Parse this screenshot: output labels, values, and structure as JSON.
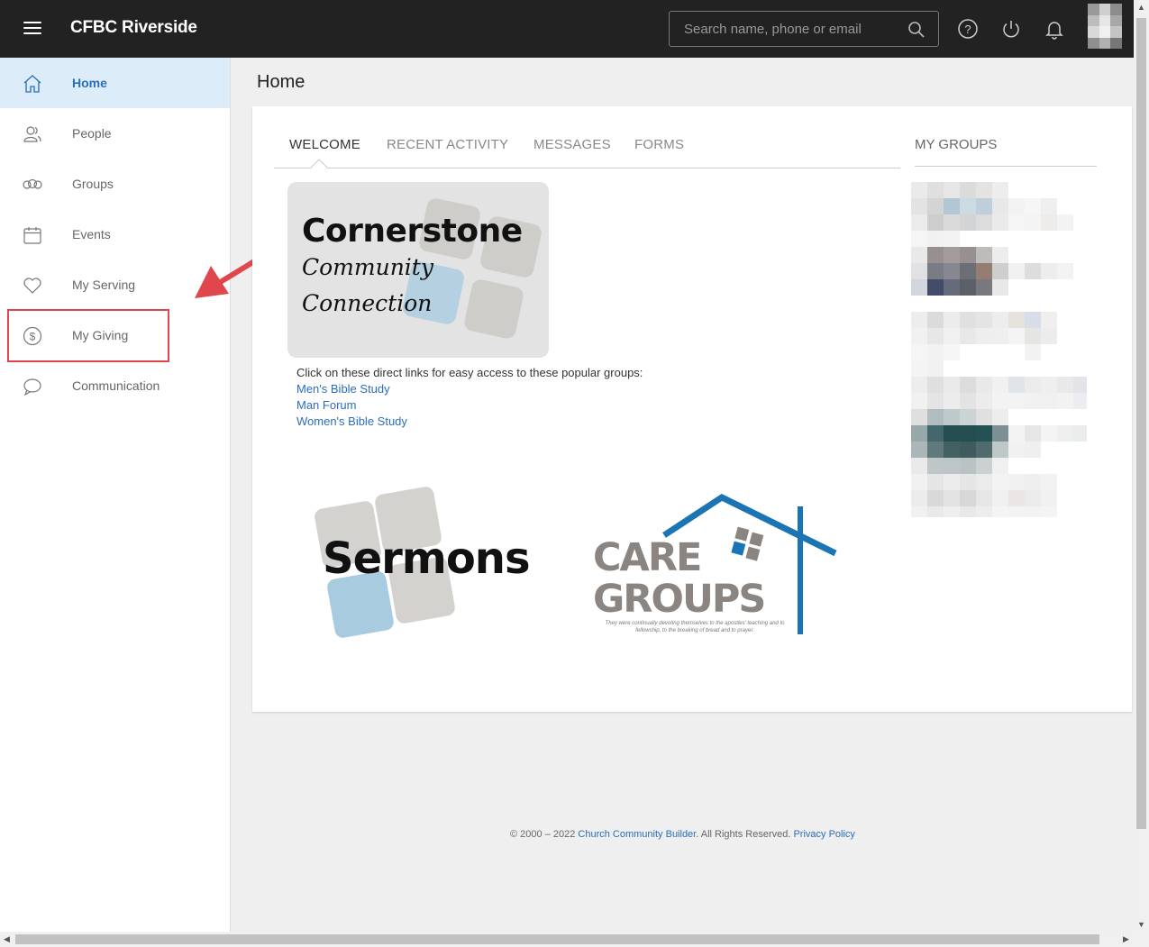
{
  "header": {
    "app_title": "CFBC Riverside",
    "search_placeholder": "Search name, phone or email"
  },
  "sidebar": {
    "items": [
      {
        "label": "Home",
        "icon": "home-icon",
        "active": true
      },
      {
        "label": "People",
        "icon": "people-icon"
      },
      {
        "label": "Groups",
        "icon": "groups-icon"
      },
      {
        "label": "Events",
        "icon": "calendar-icon"
      },
      {
        "label": "My Serving",
        "icon": "heart-icon"
      },
      {
        "label": "My Giving",
        "icon": "dollar-icon"
      },
      {
        "label": "Communication",
        "icon": "chat-icon"
      }
    ]
  },
  "main": {
    "page_title": "Home",
    "tabs": [
      "WELCOME",
      "RECENT ACTIVITY",
      "MESSAGES",
      "FORMS"
    ],
    "my_groups_heading": "MY GROUPS",
    "banner": {
      "title": "Cornerstone",
      "line1": "Community",
      "line2": "Connection"
    },
    "intro": "Click on these direct links for easy access to these popular groups:",
    "links": [
      "Men's Bible Study",
      "Man Forum",
      "Women's Bible Study"
    ],
    "sermons_label": "Sermons",
    "care_groups": {
      "line1": "CARE",
      "line2": "GROUPS",
      "tagline": "They were continually devoting themselves to the apostles' teaching and to fellowship, to the breaking of bread and to prayer."
    }
  },
  "footer": {
    "copyright": "© 2000 – 2022",
    "company": "Church Community Builder",
    "rights": ". All Rights Reserved.",
    "privacy": "Privacy Policy"
  },
  "colors": {
    "topbar": "#222222",
    "accent": "#2a6ebb",
    "active_nav_bg": "#dcecf8",
    "annotation_red": "#e0474c",
    "care_blue": "#1b75b5"
  }
}
